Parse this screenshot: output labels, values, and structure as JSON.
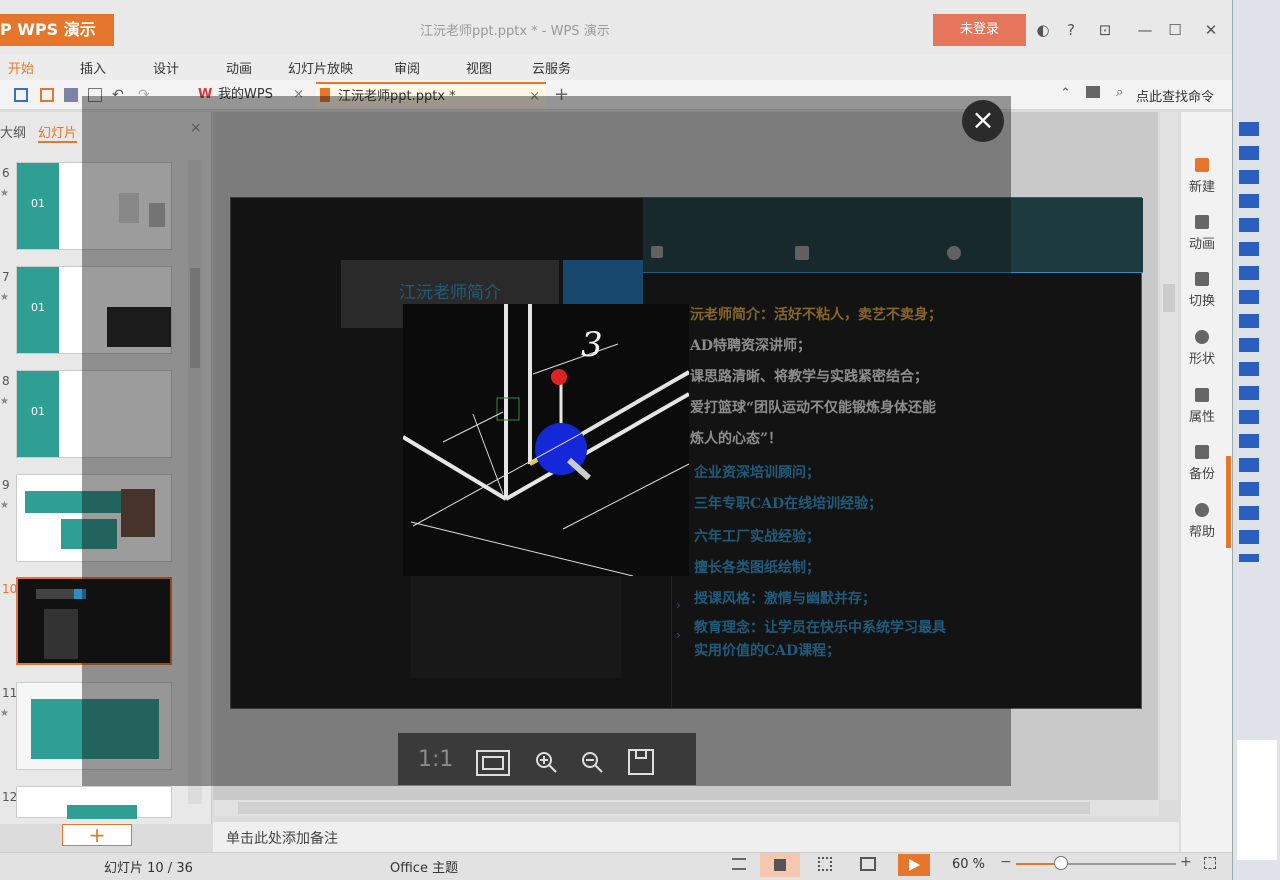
{
  "app": {
    "menu_button": "P WPS 演示",
    "window_title": "江沅老师ppt.pptx * - WPS 演示",
    "login_button": "未登录"
  },
  "ribbon_tabs": [
    "开始",
    "插入",
    "设计",
    "动画",
    "幻灯片放映",
    "审阅",
    "视图",
    "云服务"
  ],
  "doc_tabs": [
    {
      "label": "我的WPS",
      "close": "×"
    },
    {
      "label": "江沅老师ppt.pptx *",
      "close": "×"
    }
  ],
  "new_tab": "+",
  "search_command": "点此查找命令",
  "left_pane": {
    "tabs": [
      "大纲",
      "幻灯片"
    ],
    "thumbnails": [
      {
        "number": "6",
        "badge": "01"
      },
      {
        "number": "7",
        "badge": "01"
      },
      {
        "number": "8",
        "badge": "01"
      },
      {
        "number": "9"
      },
      {
        "number": "10"
      },
      {
        "number": "11"
      },
      {
        "number": "12"
      }
    ],
    "add_slide": "+"
  },
  "right_pane": [
    "新建",
    "动画",
    "切换",
    "形状",
    "属性",
    "备份",
    "帮助"
  ],
  "slide": {
    "title_box": "江沅老师简介",
    "lines": [
      {
        "text": "沅老师简介：活好不粘人，卖艺不卖身；",
        "color": "#d9a23a"
      },
      {
        "text": "AD特聘资深讲师；",
        "color": "#e6e6e6"
      },
      {
        "text": "课思路清晰、将教学与实践紧密结合；",
        "color": "#e6e6e6"
      },
      {
        "text": "爱打篮球“团队运动不仅能锻炼身体还能",
        "color": "#e6e6e6"
      },
      {
        "text": "炼人的心态”！",
        "color": "#e6e6e6"
      },
      {
        "text": "企业资深培训顾问；",
        "color": "#2a8fc5"
      },
      {
        "text": "三年专职CAD在线培训经验；",
        "color": "#2a8fc5"
      },
      {
        "text": "六年工厂实战经验；",
        "color": "#2a8fc5"
      },
      {
        "text": "擅长各类图纸绘制；",
        "color": "#2a8fc5"
      },
      {
        "text": "授课风格：激情与幽默并存；",
        "color": "#2a8fc5"
      },
      {
        "text": "教育理念：让学员在快乐中系统学习最具",
        "color": "#2a8fc5"
      },
      {
        "text": "实用价值的CAD课程；",
        "color": "#2a8fc5"
      }
    ],
    "cad_label": "3"
  },
  "viewer": {
    "close": "×",
    "actual_size": "1:1"
  },
  "notes_placeholder": "单击此处添加备注",
  "status": {
    "slide_position": "幻灯片 10 / 36",
    "theme": "Office 主题",
    "zoom": "60 %",
    "zoom_minus": "−",
    "zoom_plus": "+"
  },
  "colors": {
    "accent": "#e5762c",
    "teal": "#2f9e93"
  }
}
